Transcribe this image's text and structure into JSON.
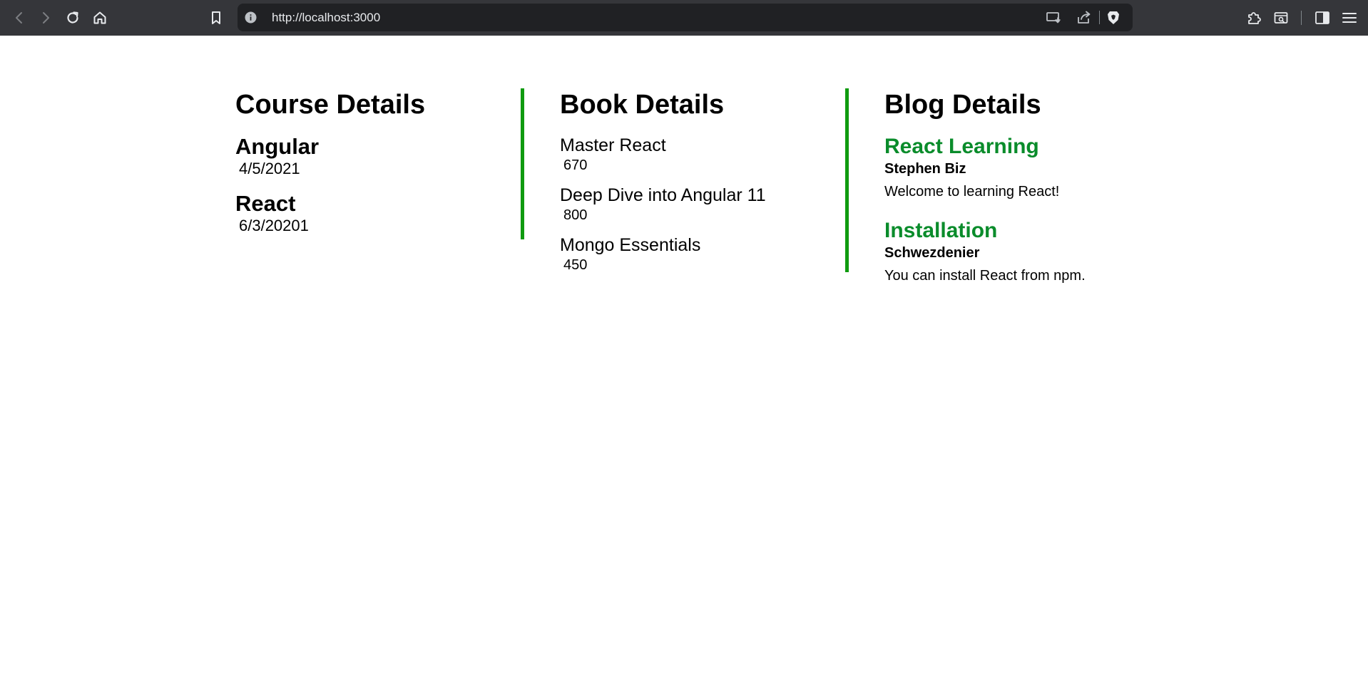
{
  "browser": {
    "url": "http://localhost:3000",
    "icons": {
      "back": "arrow-left-icon",
      "forward": "arrow-right-icon",
      "reload": "reload-icon",
      "home": "home-icon",
      "bookmark": "bookmark-icon",
      "info": "info-icon",
      "cast": "cast-icon",
      "share": "share-icon",
      "shield": "brave-shield-icon",
      "extensions": "puzzle-icon",
      "wallet": "wallet-icon",
      "sidebar": "sidebar-icon",
      "menu": "hamburger-menu-icon"
    },
    "colors": {
      "toolbar": "#35363a",
      "omnibox": "#202124"
    }
  },
  "courses": {
    "title": "Course Details",
    "items": [
      {
        "name": "Angular",
        "date": "4/5/2021"
      },
      {
        "name": "React",
        "date": "6/3/20201"
      }
    ]
  },
  "books": {
    "title": "Book Details",
    "items": [
      {
        "name": "Master React",
        "price": "670"
      },
      {
        "name": "Deep Dive into Angular 11",
        "price": "800"
      },
      {
        "name": "Mongo Essentials",
        "price": "450"
      }
    ]
  },
  "blogs": {
    "title": "Blog Details",
    "items": [
      {
        "title": "React Learning",
        "author": "Stephen Biz",
        "content": "Welcome to learning React!"
      },
      {
        "title": "Installation",
        "author": "Schwezdenier",
        "content": "You can install React from npm."
      }
    ]
  },
  "colors": {
    "divider": "#0f9b0f",
    "blog_title": "#0a8c2b"
  }
}
